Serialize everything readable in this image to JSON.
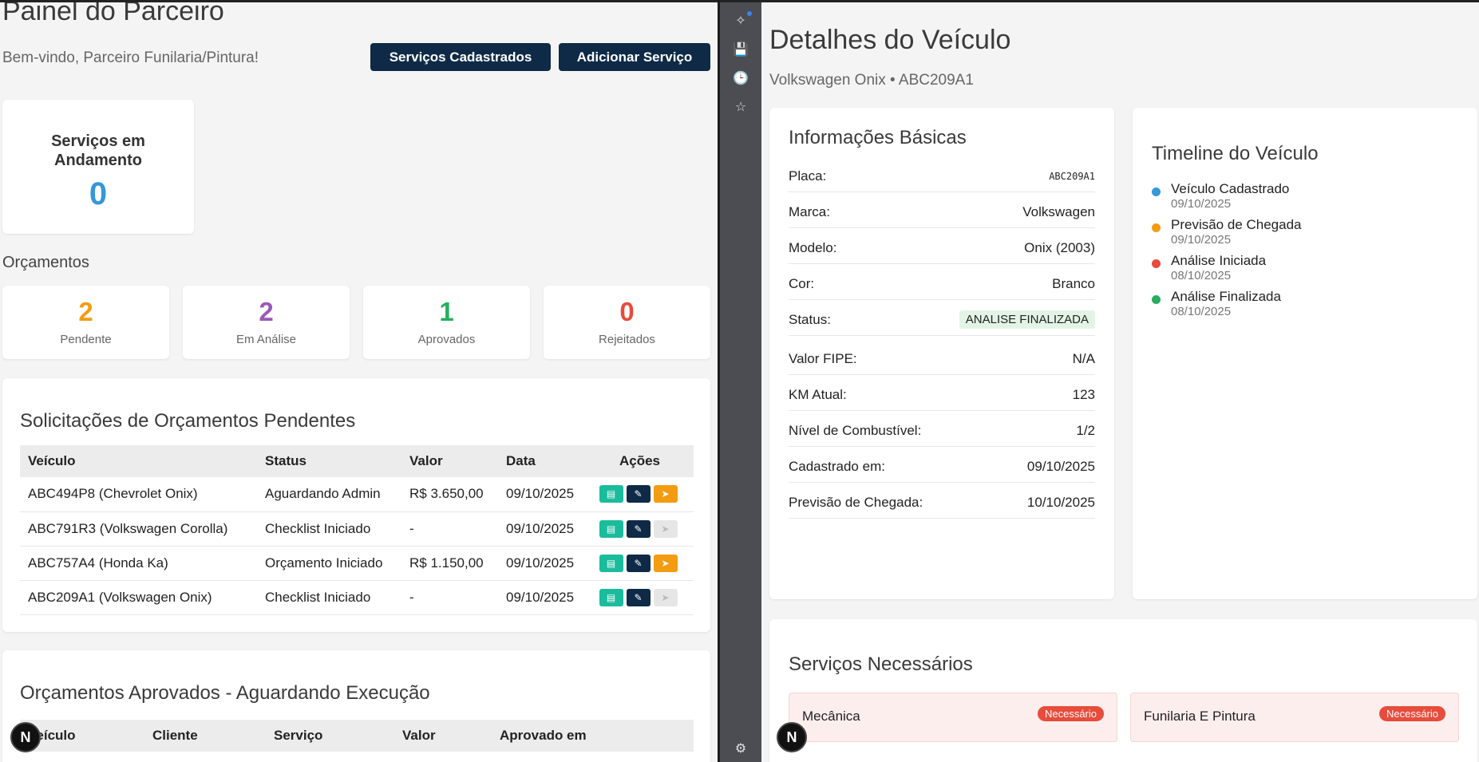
{
  "left": {
    "title": "Painel do Parceiro",
    "welcome": "Bem-vindo, Parceiro Funilaria/Pintura!",
    "buttons": {
      "services": "Serviços Cadastrados",
      "add": "Adicionar Serviço"
    },
    "in_progress": {
      "label": "Serviços em Andamento",
      "value": "0"
    },
    "budgets_title": "Orçamentos",
    "stats": [
      {
        "value": "2",
        "label": "Pendente",
        "color": "#f39c12"
      },
      {
        "value": "2",
        "label": "Em Análise",
        "color": "#9b59b6"
      },
      {
        "value": "1",
        "label": "Aprovados",
        "color": "#27ae60"
      },
      {
        "value": "0",
        "label": "Rejeitados",
        "color": "#e74c3c"
      }
    ],
    "pending": {
      "title": "Solicitações de Orçamentos Pendentes",
      "headers": [
        "Veículo",
        "Status",
        "Valor",
        "Data",
        "Ações"
      ],
      "rows": [
        {
          "vehicle": "ABC494P8 (Chevrolet Onix)",
          "status": "Aguardando Admin",
          "value": "R$ 3.650,00",
          "date": "09/10/2025",
          "send_enabled": true
        },
        {
          "vehicle": "ABC791R3 (Volkswagen Corolla)",
          "status": "Checklist Iniciado",
          "value": "-",
          "date": "09/10/2025",
          "send_enabled": false
        },
        {
          "vehicle": "ABC757A4 (Honda Ka)",
          "status": "Orçamento Iniciado",
          "value": "R$ 1.150,00",
          "date": "09/10/2025",
          "send_enabled": true
        },
        {
          "vehicle": "ABC209A1 (Volkswagen Onix)",
          "status": "Checklist Iniciado",
          "value": "-",
          "date": "09/10/2025",
          "send_enabled": false
        }
      ]
    },
    "approved": {
      "title": "Orçamentos Aprovados - Aguardando Execução",
      "headers": [
        "Veículo",
        "Cliente",
        "Serviço",
        "Valor",
        "Aprovado em"
      ]
    }
  },
  "sidebar": {
    "icons": [
      "sparkle-icon",
      "save-icon",
      "history-icon",
      "star-icon",
      "gear-icon"
    ]
  },
  "badge": "N",
  "right": {
    "title": "Detalhes do Veículo",
    "subtitle": "Volkswagen Onix • ABC209A1",
    "info": {
      "title": "Informações Básicas",
      "rows": [
        {
          "key": "Placa:",
          "value": "ABC209A1"
        },
        {
          "key": "Marca:",
          "value": "Volkswagen"
        },
        {
          "key": "Modelo:",
          "value": "Onix (2003)"
        },
        {
          "key": "Cor:",
          "value": "Branco"
        },
        {
          "key": "Status:",
          "value": "ANALISE FINALIZADA"
        },
        {
          "key": "Valor FIPE:",
          "value": "N/A"
        },
        {
          "key": "KM Atual:",
          "value": "123"
        },
        {
          "key": "Nível de Combustível:",
          "value": "1/2"
        },
        {
          "key": "Cadastrado em:",
          "value": "09/10/2025"
        },
        {
          "key": "Previsão de Chegada:",
          "value": "10/10/2025"
        }
      ]
    },
    "timeline": {
      "title": "Timeline do Veículo",
      "items": [
        {
          "label": "Veículo Cadastrado",
          "date": "09/10/2025",
          "color": "#3498db"
        },
        {
          "label": "Previsão de Chegada",
          "date": "09/10/2025",
          "color": "#f39c12"
        },
        {
          "label": "Análise Iniciada",
          "date": "08/10/2025",
          "color": "#e74c3c"
        },
        {
          "label": "Análise Finalizada",
          "date": "08/10/2025",
          "color": "#27ae60"
        }
      ]
    },
    "services": {
      "title": "Serviços Necessários",
      "items": [
        {
          "name": "Mecânica",
          "badge": "Necessário"
        },
        {
          "name": "Funilaria E Pintura",
          "badge": "Necessário"
        }
      ]
    }
  }
}
